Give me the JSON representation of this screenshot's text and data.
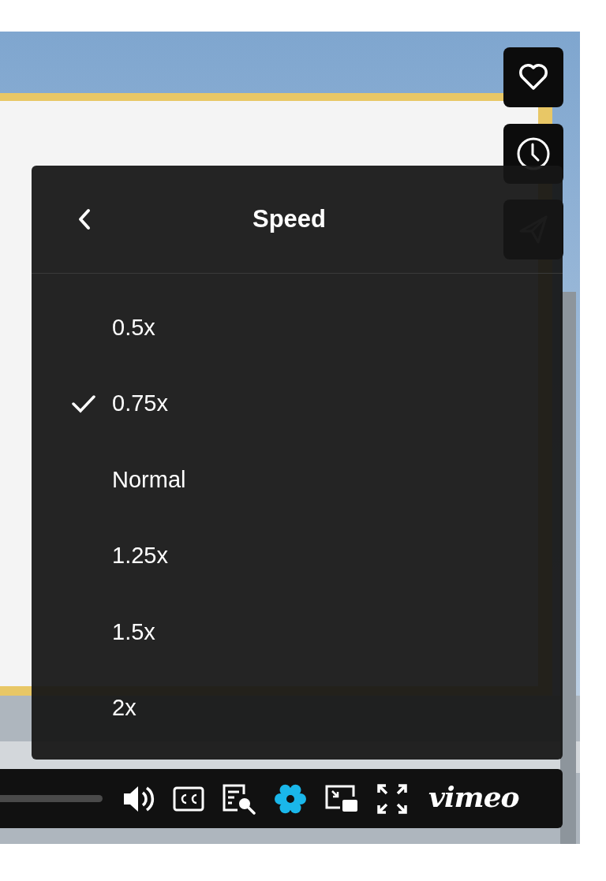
{
  "speed_menu": {
    "title": "Speed",
    "options": [
      {
        "label": "0.5x",
        "selected": false
      },
      {
        "label": "0.75x",
        "selected": true
      },
      {
        "label": "Normal",
        "selected": false
      },
      {
        "label": "1.25x",
        "selected": false
      },
      {
        "label": "1.5x",
        "selected": false
      },
      {
        "label": "2x",
        "selected": false
      }
    ]
  },
  "control_bar": {
    "controls": [
      {
        "kind": "volume",
        "active": false
      },
      {
        "kind": "captions",
        "active": false
      },
      {
        "kind": "transcript",
        "active": false
      },
      {
        "kind": "settings",
        "active": true
      },
      {
        "kind": "pip",
        "active": false
      },
      {
        "kind": "fullscreen",
        "active": false
      }
    ],
    "logo": "vimeo"
  }
}
